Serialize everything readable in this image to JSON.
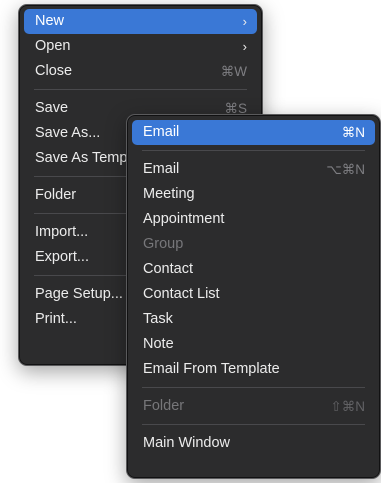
{
  "file_menu": {
    "items": [
      {
        "label": "New",
        "submenu": "›",
        "highlighted": true
      },
      {
        "label": "Open",
        "submenu": "›"
      },
      {
        "label": "Close",
        "shortcut": "⌘W"
      },
      {
        "label": "Save",
        "shortcut": "⌘S"
      },
      {
        "label": "Save As..."
      },
      {
        "label": "Save As Template..."
      },
      {
        "label": "Folder"
      },
      {
        "label": "Import..."
      },
      {
        "label": "Export..."
      },
      {
        "label": "Page Setup..."
      },
      {
        "label": "Print..."
      }
    ]
  },
  "new_submenu": {
    "items": [
      {
        "label": "Email",
        "shortcut": "⌘N",
        "highlighted": true
      },
      {
        "label": "Email",
        "shortcut": "⌥⌘N"
      },
      {
        "label": "Meeting"
      },
      {
        "label": "Appointment"
      },
      {
        "label": "Group",
        "disabled": true
      },
      {
        "label": "Contact"
      },
      {
        "label": "Contact List"
      },
      {
        "label": "Task"
      },
      {
        "label": "Note"
      },
      {
        "label": "Email From Template"
      },
      {
        "label": "Folder",
        "shortcut": "⇧⌘N",
        "disabled": true
      },
      {
        "label": "Main Window"
      }
    ]
  }
}
